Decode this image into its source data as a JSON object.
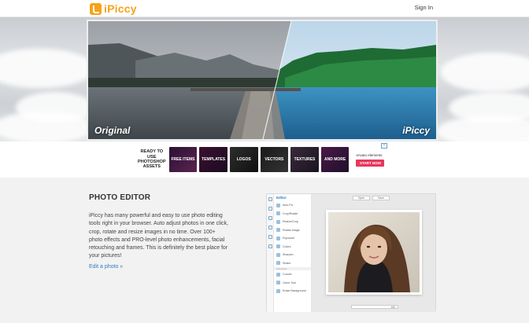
{
  "header": {
    "logo_text": "iPiccy",
    "signin_label": "Sign In"
  },
  "hero": {
    "left_label": "Original",
    "right_label": "iPiccy"
  },
  "ad": {
    "intro": "READY TO USE PHOTOSHOP ASSETS",
    "tiles": [
      "FREE ITEMS",
      "TEMPLATES",
      "LOGOS",
      "VECTORS",
      "TEXTURES",
      "AND MORE"
    ],
    "brand": "envato elements",
    "cta": "START NOW",
    "close": "×"
  },
  "editor_section": {
    "title": "PHOTO EDITOR",
    "body": "iPiccy has many powerful and easy to use photo editing tools right in your browser. Auto adjust photos in one click, crop, rotate and resize images in no time. Over 100+ photo effects and PRO-level photo enhancements, facial retouching and frames. This is definitely the best place for your pictures!",
    "link": "Edit a photo »"
  },
  "editor_mock": {
    "panel_title": "Editor",
    "rows_top": [
      "Auto Fix",
      "Crop/Rotate",
      "Resize/Crop",
      "Rotate Image",
      "Exposure",
      "Colors",
      "Sharpen",
      "Shake"
    ],
    "section_label": "Advanced",
    "rows_bottom": [
      "Curves",
      "Clone Tool",
      "Erase Background"
    ],
    "top_buttons": [
      "Open",
      "Save"
    ],
    "zoom_value": "100"
  },
  "colors": {
    "brand_orange": "#f5a31a",
    "link_blue": "#2f7bc1",
    "cta_pink": "#e8365b"
  }
}
